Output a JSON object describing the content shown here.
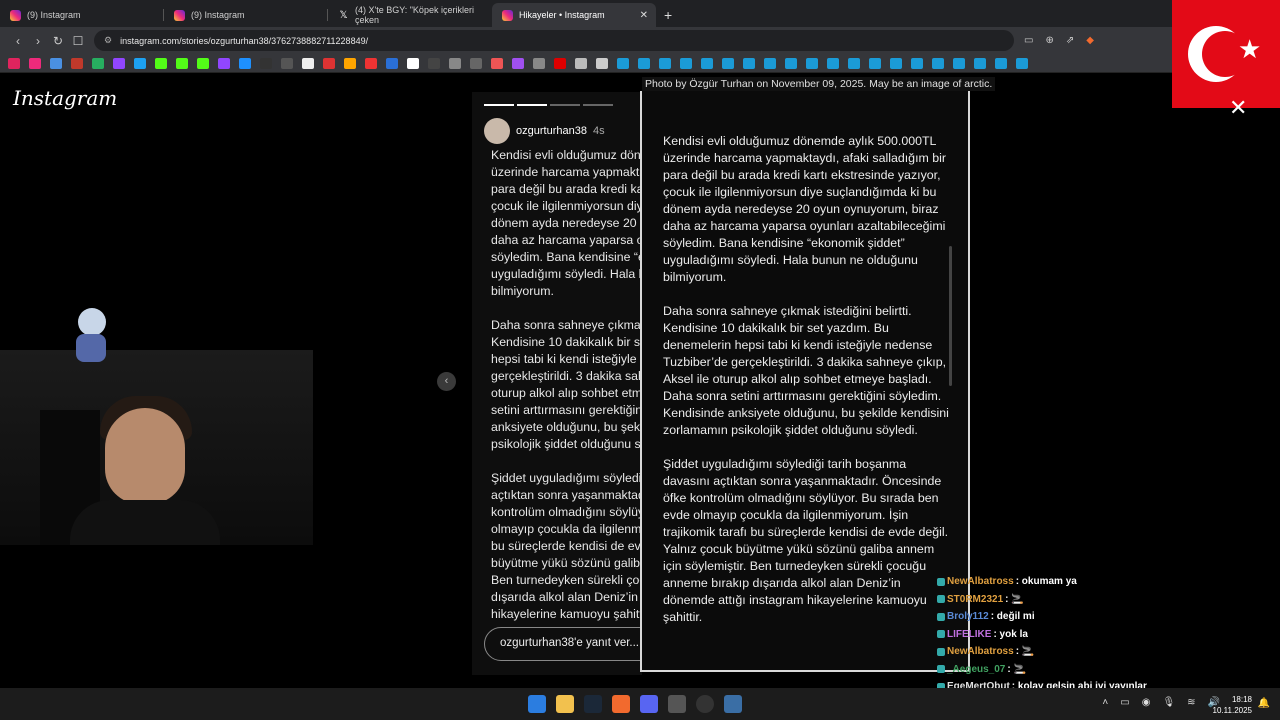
{
  "tabs": [
    {
      "title": "(9) Instagram",
      "favicon": "instagram-icon",
      "active": false
    },
    {
      "title": "(9) Instagram",
      "favicon": "instagram-icon",
      "active": false
    },
    {
      "title": "(4) X'te BGY: \"Köpek içerikleri çeken",
      "favicon": "x-icon",
      "active": false
    },
    {
      "title": "Hikayeler • Instagram",
      "favicon": "instagram-icon",
      "active": true
    }
  ],
  "address": {
    "url": "instagram.com/stories/ozgurturhan38/3762738882711228849/"
  },
  "page": {
    "logo": "Instagram",
    "caption": "Photo by Özgür Turhan on November 09, 2025. May be an image of arctic."
  },
  "story": {
    "username": "ozgurturhan38",
    "time": "4s",
    "reply_placeholder": "ozgurturhan38'e yanıt ver...",
    "text": "Kendisi evli olduğumuz dönemde aylık 500.000TL üzerinde harcama yapmaktaydı, afaki salladığım bir para değil bu arada kredi kartı ekstresinde yazıyor, çocuk ile ilgilenmiyorsun diye suçlandığımda ki bu dönem ayda neredeyse 20 oyun oynuyorum, biraz daha az harcama yaparsa oyunları azaltabileceğimi söyledim. Bana kendisine “ekonomik şiddet” uyguladığımı söyledi. Hala bunun ne olduğunu bilmiyorum.\n\nDaha sonra sahneye çıkmak istediğini belirtti. Kendisine 10 dakikalık bir set yazdım. Bu denemelerin hepsi tabi ki kendi isteğiyle nedense Tuzbiber’de gerçekleştirildi. 3 dakika sahneye çıkıp, Aksel ile oturup alkol alıp sohbet etmeye başladı. Daha sonra setini arttırmasını gerektiğini söyledim. Kendisinde anksiyete olduğunu, bu şekilde kendisini zorlamamın psikolojik şiddet olduğunu söyledi.\n\nŞiddet uyguladığımı söylediği tarih boşanma davasını açtıktan sonra yaşanmaktadır. Öncesinde öfke kontrolüm olmadığını söylüyor. Bu sırada ben evde olmayıp çocukla da ilgilenmiyorum. İşin trajikomik tarafı bu süreçlerde kendisi de evde değil. Yalnız çocuk büyütme yükü sözünü galiba annem için söylemiştir. Ben turnedeyken sürekli çocuğu anneme bırakıp dışarıda alkol alan Deniz’in dönemde attığı instagram hikayelerine kamuoyu şahittir."
  },
  "chat": [
    {
      "user": "NewAlbatross",
      "color": "#e0a040",
      "msg": ": okumam ya"
    },
    {
      "user": "ST0RM2321",
      "color": "#e0a040",
      "msg": ": 🚬"
    },
    {
      "user": "Broly112",
      "color": "#5a8ad6",
      "msg": ": değil mi"
    },
    {
      "user": "LIFELIKE",
      "color": "#c070e0",
      "msg": ": yok la"
    },
    {
      "user": "NewAlbatross",
      "color": "#e0a040",
      "msg": ": 🚬"
    },
    {
      "user": "_Aegeus_07",
      "color": "#40a060",
      "msg": ": 🚬"
    },
    {
      "user": "EgeMertObut",
      "color": "#e0e0e0",
      "msg": ": kolay gelsin abi iyi yayınlar"
    }
  ],
  "taskbar": {
    "time": "18:18",
    "date": "10.11.2025"
  },
  "colors": {
    "accent_instagram": "#ee2a7b",
    "flag_red": "#e30a17",
    "chrome_bg": "#35363a"
  }
}
